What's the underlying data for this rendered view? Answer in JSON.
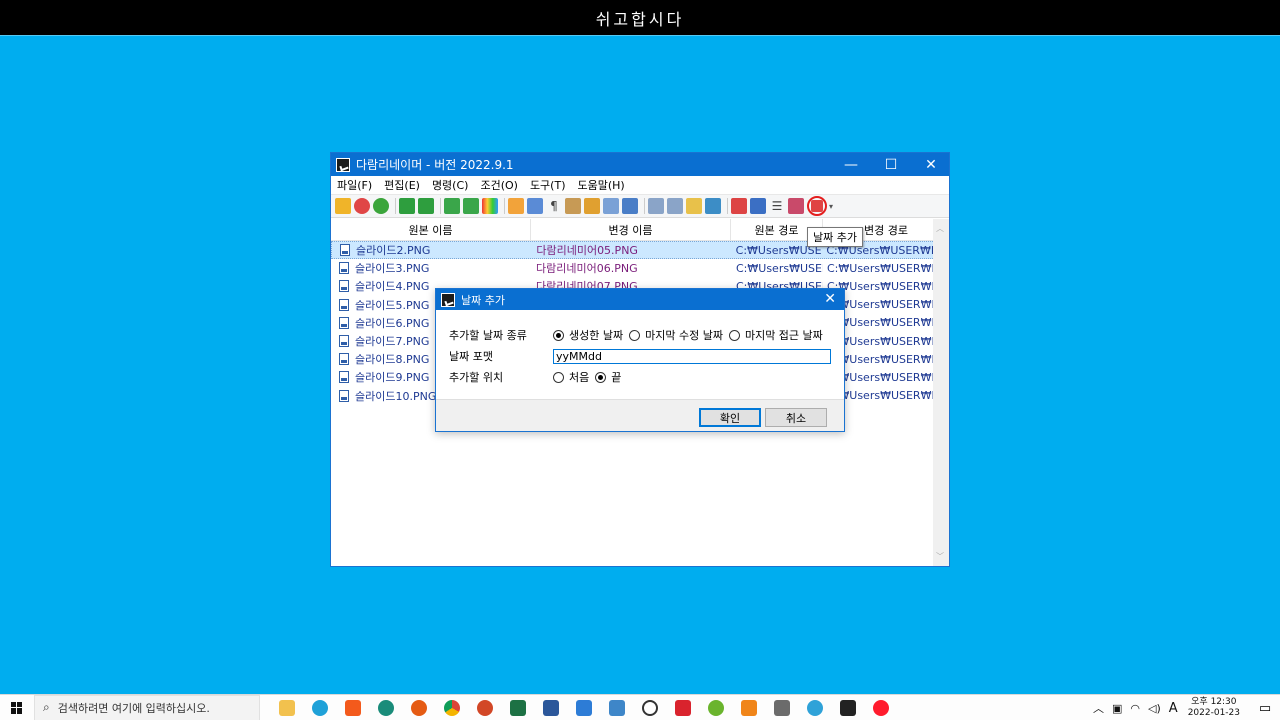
{
  "top_banner": "쉬고합시다",
  "app": {
    "title": "다람리네이머 - 버전 2022.9.1",
    "controls": {
      "minimize": "—",
      "maximize": "☐",
      "close": "✕"
    },
    "menu": [
      "파일(F)",
      "편집(E)",
      "명령(C)",
      "조건(O)",
      "도구(T)",
      "도움말(H)"
    ],
    "tooltip": "날짜 추가",
    "columns": [
      "원본 이름",
      "변경 이름",
      "원본 경로",
      "변경 경로"
    ],
    "rows": [
      {
        "orig": "슬라이드2.PNG",
        "new": "다람리네미어05.PNG",
        "path": "C:₩Users₩USER₩",
        "newpath": "C:₩Users₩USER₩I"
      },
      {
        "orig": "슬라이드3.PNG",
        "new": "다람리네미어06.PNG",
        "path": "C:₩Users₩USER₩",
        "newpath": "C:₩Users₩USER₩I"
      },
      {
        "orig": "슬라이드4.PNG",
        "new": "다람리네미어07.PNG",
        "path": "C:₩Users₩USER₩",
        "newpath": "C:₩Users₩USER₩I"
      },
      {
        "orig": "슬라이드5.PNG",
        "new": "",
        "path": "",
        "newpath": "C:₩Users₩USER₩I"
      },
      {
        "orig": "슬라이드6.PNG",
        "new": "",
        "path": "",
        "newpath": "C:₩Users₩USER₩I"
      },
      {
        "orig": "슬라이드7.PNG",
        "new": "",
        "path": "",
        "newpath": "C:₩Users₩USER₩I"
      },
      {
        "orig": "슬라이드8.PNG",
        "new": "",
        "path": "",
        "newpath": "C:₩Users₩USER₩I"
      },
      {
        "orig": "슬라이드9.PNG",
        "new": "",
        "path": "",
        "newpath": "C:₩Users₩USER₩I"
      },
      {
        "orig": "슬라이드10.PNG",
        "new": "",
        "path": "",
        "newpath": "C:₩Users₩USER₩I"
      }
    ]
  },
  "dialog": {
    "title": "날짜 추가",
    "close": "✕",
    "type_label": "추가할 날짜 종류",
    "type_options": [
      "생성한 날짜",
      "마지막 수정 날짜",
      "마지막 접근 날짜"
    ],
    "format_label": "날짜 포맷",
    "format_value": "yyMMdd",
    "position_label": "추가할 위치",
    "position_options": [
      "처음",
      "끝"
    ],
    "ok": "확인",
    "cancel": "취소"
  },
  "taskbar": {
    "search_placeholder": "검색하려면 여기에 입력하십시오.",
    "clock_time": "오후 12:30",
    "clock_date": "2022-01-23",
    "ime": "A"
  }
}
